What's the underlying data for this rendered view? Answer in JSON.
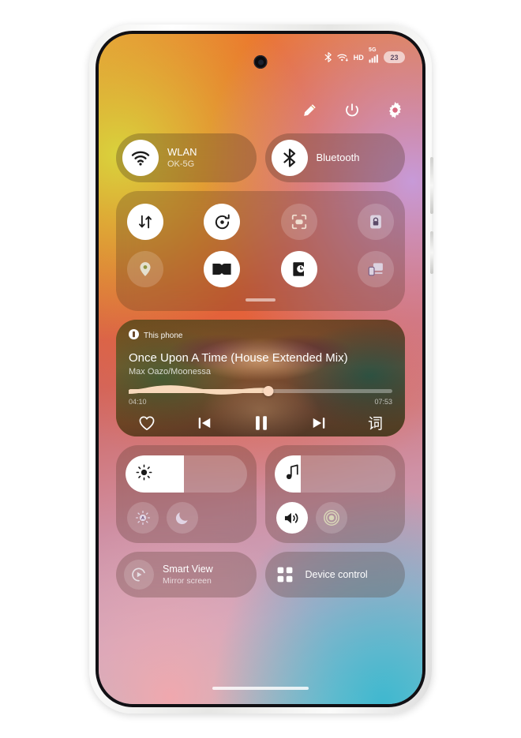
{
  "status_bar": {
    "bluetooth_icon": "bluetooth-icon",
    "wifi_icon": "wifi-icon",
    "hd_label": "HD",
    "network_label": "5G",
    "signal_icon": "signal-bars-icon",
    "battery_level": "23"
  },
  "header": {
    "edit_icon": "pencil-icon",
    "power_icon": "power-icon",
    "settings_icon": "gear-icon"
  },
  "connectivity": [
    {
      "name": "wlan",
      "icon": "wifi-icon",
      "title": "WLAN",
      "subtitle": "OK-5G",
      "active": true
    },
    {
      "name": "bluetooth",
      "icon": "bluetooth-icon",
      "title": "Bluetooth",
      "subtitle": "",
      "active": true
    }
  ],
  "toggles": [
    {
      "name": "mobile-data",
      "icon": "data-transfer-icon",
      "active": true
    },
    {
      "name": "auto-sync",
      "icon": "sync-icon",
      "active": true
    },
    {
      "name": "scan",
      "icon": "scan-frame-icon",
      "active": false
    },
    {
      "name": "rotation-lock",
      "icon": "rotation-lock-icon",
      "active": false
    },
    {
      "name": "location",
      "icon": "location-pin-icon",
      "active": false
    },
    {
      "name": "dolby-atmos",
      "icon": "dolby-icon",
      "active": true
    },
    {
      "name": "reading-mode",
      "icon": "book-clock-icon",
      "active": true
    },
    {
      "name": "screen-cast",
      "icon": "screen-cast-icon",
      "active": false
    }
  ],
  "media": {
    "source_icon": "device-phone-icon",
    "source_label": "This phone",
    "title": "Once Upon A Time (House Extended Mix)",
    "artist": "Max Oazo/Moonessa",
    "elapsed": "04:10",
    "duration": "07:53",
    "progress_percent": 53,
    "controls": {
      "favorite_icon": "heart-icon",
      "previous_icon": "previous-track-icon",
      "pause_icon": "pause-icon",
      "next_icon": "next-track-icon",
      "lyrics_label": "词"
    }
  },
  "brightness": {
    "slider_icon": "brightness-icon",
    "value_percent": 48,
    "auto_button": {
      "name": "auto-brightness",
      "icon": "auto-brightness-icon",
      "active": false
    },
    "dark_button": {
      "name": "dark-mode",
      "icon": "moon-icon",
      "active": false
    }
  },
  "volume": {
    "slider_icon": "music-note-icon",
    "value_percent": 22,
    "speaker_button": {
      "name": "sound-mode",
      "icon": "speaker-icon",
      "active": true
    },
    "vibrate_button": {
      "name": "vibration",
      "icon": "vibration-icon",
      "active": false
    }
  },
  "bottom": [
    {
      "name": "smart-view",
      "icon": "cast-play-icon",
      "title": "Smart View",
      "subtitle": "Mirror screen"
    },
    {
      "name": "device-control",
      "icon": "grid-dots-icon",
      "title": "Device control",
      "subtitle": ""
    }
  ],
  "colors": {
    "accent_white": "#ffffff",
    "progress_fill": "#f8d9bb",
    "battery_pill": "#dcc8e0"
  }
}
